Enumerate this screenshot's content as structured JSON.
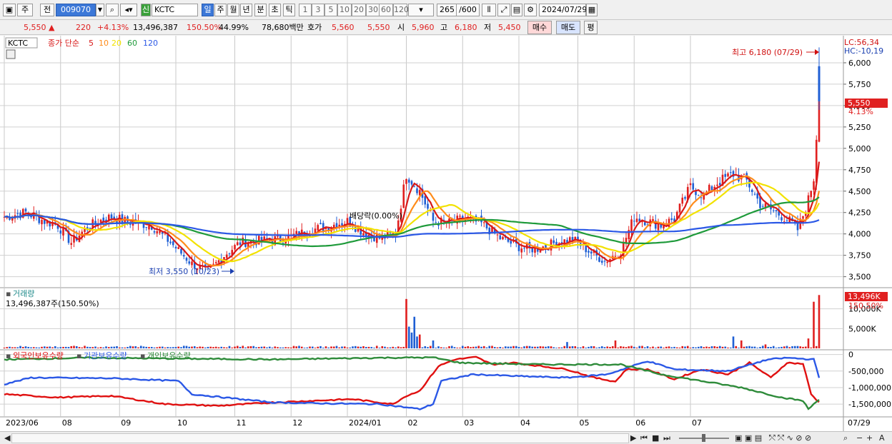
{
  "toolbar": {
    "period_select": "주",
    "prev_label": "전",
    "code": "009070",
    "credit_label": "신",
    "name": "KCTC",
    "periods": [
      "일",
      "주",
      "월",
      "년",
      "분",
      "초",
      "틱"
    ],
    "active_period": "일",
    "intervals": [
      "1",
      "3",
      "5",
      "10",
      "20",
      "30",
      "60",
      "120"
    ],
    "count": "265",
    "count_max": "/600",
    "date": "2024/07/29"
  },
  "quote": {
    "price": "5,550",
    "arrow": "▲",
    "change": "220",
    "change_pct": "+4.13%",
    "volume": "13,496,387",
    "vol_ratio": "150.50%",
    "turnover": "44.99%",
    "amount": "78,680백만",
    "bid_label": "호가",
    "ask": "5,560",
    "bid": "5,550",
    "open_label": "시",
    "open": "5,960",
    "high_label": "고",
    "high": "6,180",
    "low_label": "저",
    "low": "5,450",
    "buy_label": "매수",
    "sell_label": "매도",
    "eval_label": "평"
  },
  "legend": {
    "stock": "KCTC",
    "ma_title": "종가 단순",
    "ma_periods": [
      "5",
      "10",
      "20",
      "60",
      "120"
    ],
    "volume_title": "거래량",
    "volume_value": "13,496,387주(150.50%)",
    "holdings": [
      "외국인보유수량",
      "기관보유수량",
      "개인보유수량"
    ]
  },
  "annotations": {
    "high": "최고 6,180 (07/29)",
    "low": "최저 3,550 (10/23)",
    "dividend": "배당락(0.00%)",
    "lc": "LC:56,34",
    "hc": "HC:-10,19",
    "last_price": "5,550",
    "last_pct": "4.13%",
    "vol_badge": "13,496K",
    "vol_pct": "150.50%"
  },
  "colors": {
    "up": "#e02020",
    "down": "#1f5fd4",
    "ma5": "#d81818",
    "ma10": "#ff8c1a",
    "ma20": "#f2e200",
    "ma60": "#1e9a3a",
    "ma120": "#2b58e6",
    "foreign": "#e01010",
    "institution": "#2b58e6",
    "individual": "#2e8b3a"
  },
  "chart_data": {
    "type": "line",
    "title": "KCTC",
    "x_ticks": [
      "2023/06",
      "08",
      "09",
      "10",
      "11",
      "12",
      "2024/01",
      "02",
      "03",
      "04",
      "05",
      "06",
      "07",
      "07/29"
    ],
    "price_axis": {
      "ticks": [
        "6,000",
        "5,750",
        "5,500",
        "5,250",
        "5,000",
        "4,750",
        "4,500",
        "4,250",
        "4,000",
        "3,750",
        "3,500"
      ],
      "ylim": [
        3380,
        6300
      ]
    },
    "volume_axis": {
      "ticks": [
        "10,000K",
        "5,000K"
      ],
      "ylim": [
        0,
        15000000
      ]
    },
    "holding_axis": {
      "ticks": [
        "0",
        "-500,000",
        "-1,000,000",
        "-1,500,000"
      ],
      "ylim": [
        -1800000,
        100000
      ]
    },
    "price_anchors": [
      [
        0,
        4200
      ],
      [
        8,
        4250
      ],
      [
        15,
        4150
      ],
      [
        20,
        4100
      ],
      [
        25,
        3900
      ],
      [
        30,
        4050
      ],
      [
        35,
        4150
      ],
      [
        40,
        4200
      ],
      [
        45,
        4150
      ],
      [
        55,
        4100
      ],
      [
        62,
        3900
      ],
      [
        70,
        3650
      ],
      [
        76,
        3560
      ],
      [
        82,
        3750
      ],
      [
        88,
        3900
      ],
      [
        95,
        3920
      ],
      [
        105,
        3950
      ],
      [
        115,
        4050
      ],
      [
        122,
        4100
      ],
      [
        128,
        4150
      ],
      [
        134,
        4020
      ],
      [
        140,
        3950
      ],
      [
        146,
        4000
      ],
      [
        150,
        4700
      ],
      [
        155,
        4500
      ],
      [
        160,
        4150
      ],
      [
        166,
        4130
      ],
      [
        172,
        4180
      ],
      [
        178,
        4120
      ],
      [
        185,
        3950
      ],
      [
        192,
        3850
      ],
      [
        198,
        3820
      ],
      [
        205,
        3890
      ],
      [
        212,
        3940
      ],
      [
        218,
        3800
      ],
      [
        224,
        3680
      ],
      [
        230,
        3800
      ],
      [
        235,
        4200
      ],
      [
        240,
        4150
      ],
      [
        245,
        4100
      ],
      [
        250,
        4180
      ],
      [
        256,
        4550
      ],
      [
        261,
        4450
      ],
      [
        266,
        4600
      ],
      [
        272,
        4700
      ],
      [
        277,
        4620
      ],
      [
        282,
        4350
      ],
      [
        288,
        4250
      ],
      [
        293,
        4150
      ],
      [
        296,
        4050
      ],
      [
        299,
        4300
      ],
      [
        300,
        4400
      ],
      [
        302,
        4650
      ],
      [
        304,
        5550
      ]
    ],
    "vol_spikes": [
      [
        150,
        12.5
      ],
      [
        151,
        5.5
      ],
      [
        152,
        4
      ],
      [
        153,
        8
      ],
      [
        154,
        3
      ],
      [
        155,
        3.5
      ],
      [
        160,
        2
      ],
      [
        210,
        1.6
      ],
      [
        228,
        2
      ],
      [
        272,
        3
      ],
      [
        275,
        2
      ],
      [
        284,
        1
      ],
      [
        300,
        2.5
      ],
      [
        302,
        11.8
      ],
      [
        304,
        13.5
      ]
    ],
    "foreign_anchors": [
      [
        0,
        -1200000
      ],
      [
        20,
        -1300000
      ],
      [
        40,
        -1250000
      ],
      [
        60,
        -1500000
      ],
      [
        80,
        -1550000
      ],
      [
        100,
        -1450000
      ],
      [
        115,
        -1400000
      ],
      [
        130,
        -1350000
      ],
      [
        145,
        -1500000
      ],
      [
        150,
        -1250000
      ],
      [
        155,
        -1100000
      ],
      [
        162,
        -350000
      ],
      [
        168,
        -150000
      ],
      [
        176,
        -80000
      ],
      [
        182,
        -300000
      ],
      [
        190,
        -250000
      ],
      [
        200,
        -350000
      ],
      [
        210,
        -450000
      ],
      [
        220,
        -700000
      ],
      [
        228,
        -820000
      ],
      [
        232,
        -450000
      ],
      [
        240,
        -450000
      ],
      [
        250,
        -750000
      ],
      [
        260,
        -450000
      ],
      [
        270,
        -600000
      ],
      [
        278,
        -250000
      ],
      [
        286,
        -700000
      ],
      [
        292,
        -250000
      ],
      [
        298,
        -280000
      ],
      [
        301,
        -1200000
      ],
      [
        304,
        -1450000
      ]
    ],
    "institution_anchors": [
      [
        0,
        -900000
      ],
      [
        10,
        -700000
      ],
      [
        40,
        -720000
      ],
      [
        65,
        -800000
      ],
      [
        70,
        -1200000
      ],
      [
        100,
        -1450000
      ],
      [
        120,
        -1480000
      ],
      [
        140,
        -1500000
      ],
      [
        148,
        -1580000
      ],
      [
        155,
        -1650000
      ],
      [
        160,
        -1500000
      ],
      [
        163,
        -800000
      ],
      [
        175,
        -600000
      ],
      [
        190,
        -650000
      ],
      [
        210,
        -700000
      ],
      [
        225,
        -600000
      ],
      [
        235,
        -330000
      ],
      [
        240,
        -200000
      ],
      [
        250,
        -450000
      ],
      [
        270,
        -500000
      ],
      [
        285,
        -150000
      ],
      [
        292,
        -100000
      ],
      [
        302,
        -150000
      ],
      [
        304,
        -700000
      ]
    ],
    "individual_anchors": [
      [
        0,
        -150000
      ],
      [
        30,
        -100000
      ],
      [
        60,
        -120000
      ],
      [
        100,
        -150000
      ],
      [
        140,
        -100000
      ],
      [
        160,
        -90000
      ],
      [
        170,
        -250000
      ],
      [
        200,
        -300000
      ],
      [
        230,
        -300000
      ],
      [
        245,
        -600000
      ],
      [
        260,
        -800000
      ],
      [
        275,
        -1000000
      ],
      [
        290,
        -1300000
      ],
      [
        298,
        -1400000
      ],
      [
        300,
        -1650000
      ],
      [
        304,
        -1350000
      ]
    ]
  }
}
